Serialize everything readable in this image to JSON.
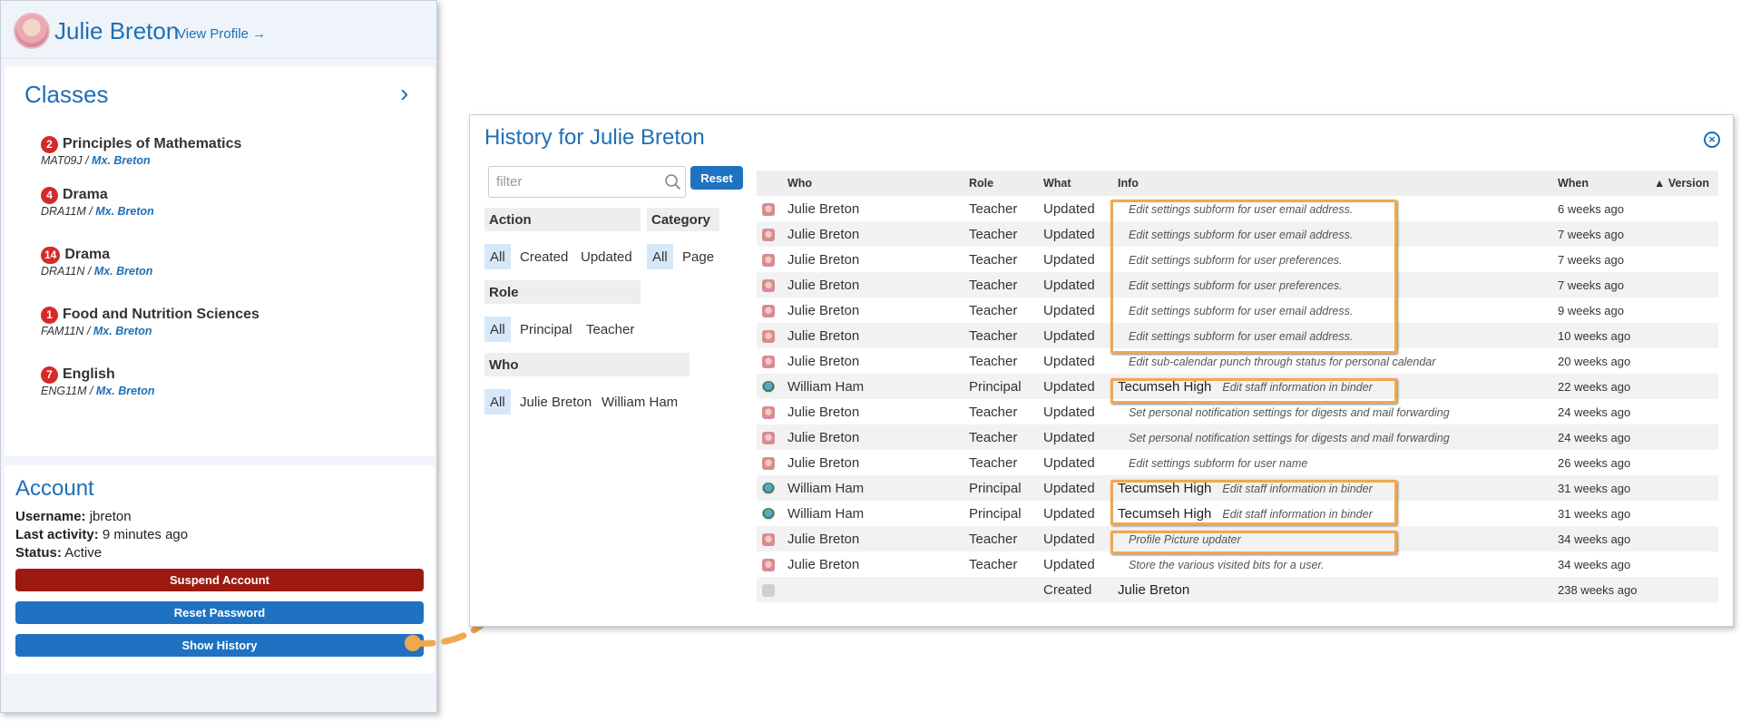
{
  "profile": {
    "name": "Julie Breton",
    "view_profile": "View Profile →"
  },
  "classes": {
    "title": "Classes",
    "items": [
      {
        "count": "2",
        "name": "Principles of Mathematics",
        "code": "MAT09J",
        "teacher": "Mx. Breton"
      },
      {
        "count": "4",
        "name": "Drama",
        "code": "DRA11M",
        "teacher": "Mx. Breton"
      },
      {
        "count": "14",
        "name": "Drama",
        "code": "DRA11N",
        "teacher": "Mx. Breton"
      },
      {
        "count": "1",
        "name": "Food and Nutrition Sciences",
        "code": "FAM11N",
        "teacher": "Mx. Breton"
      },
      {
        "count": "7",
        "name": "English",
        "code": "ENG11M",
        "teacher": "Mx. Breton"
      }
    ]
  },
  "account": {
    "title": "Account",
    "username_label": "Username:",
    "username": "jbreton",
    "last_activity_label": "Last activity:",
    "last_activity": "9 minutes ago",
    "status_label": "Status:",
    "status": "Active",
    "suspend_label": "Suspend Account",
    "reset_password_label": "Reset Password",
    "show_history_label": "Show History"
  },
  "history": {
    "title": "History for Julie Breton",
    "filter_placeholder": "filter",
    "reset_label": "Reset",
    "facets": {
      "action": {
        "label": "Action",
        "options": [
          "All",
          "Created",
          "Updated"
        ]
      },
      "category": {
        "label": "Category",
        "options": [
          "All",
          "Page"
        ]
      },
      "role": {
        "label": "Role",
        "options": [
          "All",
          "Principal",
          "Teacher"
        ]
      },
      "who": {
        "label": "Who",
        "options": [
          "All",
          "Julie Breton",
          "William Ham"
        ]
      }
    },
    "columns": {
      "who": "Who",
      "role": "Role",
      "what": "What",
      "info": "Info",
      "when": "When",
      "version": "▲ Version"
    },
    "rows": [
      {
        "icon": "teacher",
        "who": "Julie Breton",
        "role": "Teacher",
        "what": "Updated",
        "school": "",
        "info": "Edit settings subform for user email address.",
        "when": "6 weeks ago"
      },
      {
        "icon": "teacher",
        "who": "Julie Breton",
        "role": "Teacher",
        "what": "Updated",
        "school": "",
        "info": "Edit settings subform for user email address.",
        "when": "7 weeks ago"
      },
      {
        "icon": "teacher",
        "who": "Julie Breton",
        "role": "Teacher",
        "what": "Updated",
        "school": "",
        "info": "Edit settings subform for user preferences.",
        "when": "7 weeks ago"
      },
      {
        "icon": "teacher",
        "who": "Julie Breton",
        "role": "Teacher",
        "what": "Updated",
        "school": "",
        "info": "Edit settings subform for user preferences.",
        "when": "7 weeks ago"
      },
      {
        "icon": "teacher",
        "who": "Julie Breton",
        "role": "Teacher",
        "what": "Updated",
        "school": "",
        "info": "Edit settings subform for user email address.",
        "when": "9 weeks ago"
      },
      {
        "icon": "teacher",
        "who": "Julie Breton",
        "role": "Teacher",
        "what": "Updated",
        "school": "",
        "info": "Edit settings subform for user email address.",
        "when": "10 weeks ago"
      },
      {
        "icon": "teacher",
        "who": "Julie Breton",
        "role": "Teacher",
        "what": "Updated",
        "school": "",
        "info": "Edit sub-calendar punch through status for personal calendar",
        "when": "20 weeks ago"
      },
      {
        "icon": "principal",
        "who": "William Ham",
        "role": "Principal",
        "what": "Updated",
        "school": "Tecumseh High",
        "info": "Edit staff information in binder",
        "when": "22 weeks ago"
      },
      {
        "icon": "teacher",
        "who": "Julie Breton",
        "role": "Teacher",
        "what": "Updated",
        "school": "",
        "info": "Set personal notification settings for digests and mail forwarding",
        "when": "24 weeks ago"
      },
      {
        "icon": "teacher",
        "who": "Julie Breton",
        "role": "Teacher",
        "what": "Updated",
        "school": "",
        "info": "Set personal notification settings for digests and mail forwarding",
        "when": "24 weeks ago"
      },
      {
        "icon": "teacher",
        "who": "Julie Breton",
        "role": "Teacher",
        "what": "Updated",
        "school": "",
        "info": "Edit settings subform for user name",
        "when": "26 weeks ago"
      },
      {
        "icon": "principal",
        "who": "William Ham",
        "role": "Principal",
        "what": "Updated",
        "school": "Tecumseh High",
        "info": "Edit staff information in binder",
        "when": "31 weeks ago"
      },
      {
        "icon": "principal",
        "who": "William Ham",
        "role": "Principal",
        "what": "Updated",
        "school": "Tecumseh High",
        "info": "Edit staff information in binder",
        "when": "31 weeks ago"
      },
      {
        "icon": "teacher",
        "who": "Julie Breton",
        "role": "Teacher",
        "what": "Updated",
        "school": "",
        "info": "Profile Picture updater",
        "when": "34 weeks ago"
      },
      {
        "icon": "teacher",
        "who": "Julie Breton",
        "role": "Teacher",
        "what": "Updated",
        "school": "",
        "info": "Store the various visited bits for a user.",
        "when": "34 weeks ago"
      },
      {
        "icon": "system",
        "who": "",
        "role": "",
        "what": "Created",
        "school": "Julie Breton",
        "info": "",
        "when": "238 weeks ago"
      }
    ]
  },
  "colors": {
    "accent": "#1f6fb5",
    "danger": "#9c1a10",
    "highlight": "#f0a850",
    "badge": "#d42a2a"
  }
}
